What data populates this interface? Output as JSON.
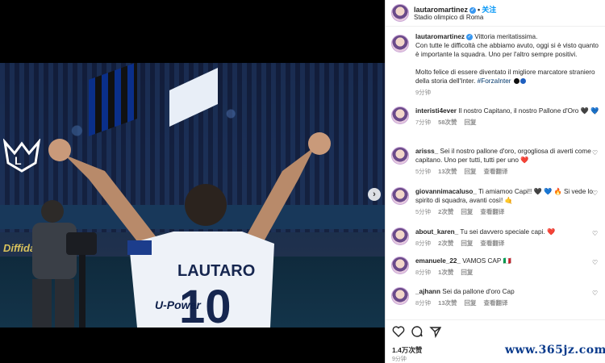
{
  "post": {
    "username": "lautaromartinez",
    "follow_label": "关注",
    "location": "Stadio olimpico di Roma",
    "likes": "1.4万次赞",
    "time_ago": "9分钟"
  },
  "photo": {
    "jersey_name": "LAUTARO",
    "jersey_number": "10",
    "sponsor": "U-Power",
    "banner_text": "Diffida"
  },
  "caption": {
    "username": "lautaromartinez",
    "line1": "Vittoria meritatissima.",
    "line2": "Con tutte le difficoltà che abbiamo avuto, oggi si è visto quanto è importante la squadra. Uno per l'altro sempre positivi.",
    "line3": "Molto felice di essere diventato il migliore marcatore straniero della storia dell'Inter.",
    "hashtag": "#ForzaInter",
    "time": "9分钟",
    "colors": [
      "#111111",
      "#1f5fbf"
    ]
  },
  "comments": [
    {
      "user": "interisti4ever",
      "text": "Il nostro Capitano, il nostro Pallone d'Oro 🖤 💙",
      "time": "7分钟",
      "likes": "58次赞",
      "reply": "回复",
      "translate": ""
    },
    {
      "user": "arisss_",
      "text": "Sei il nostro pallone d'oro, orgogliosa di averti come capitano. Uno per tutti, tutti per uno ❤️",
      "time": "5分钟",
      "likes": "13次赞",
      "reply": "回复",
      "translate": "查看翻译"
    },
    {
      "user": "giovannimacaluso_",
      "text": "Ti amiamoo Capi!! 🖤 💙 🔥 Si vede lo spirito di squadra, avanti così! 🤙",
      "time": "5分钟",
      "likes": "2次赞",
      "reply": "回复",
      "translate": "查看翻译"
    },
    {
      "user": "about_karen_",
      "text": "Tu sei davvero speciale capi. ❤️",
      "time": "8分钟",
      "likes": "2次赞",
      "reply": "回复",
      "translate": "查看翻译"
    },
    {
      "user": "emanuele_22_",
      "text": "VAMOS CAP 🇮🇹",
      "time": "8分钟",
      "likes": "1次赞",
      "reply": "回复",
      "translate": ""
    },
    {
      "user": "_ajhann",
      "text": "Sei da pallone d'oro Cap",
      "time": "8分钟",
      "likes": "13次赞",
      "reply": "回复",
      "translate": "查看翻译"
    }
  ],
  "watermark": "www.365jz.com"
}
